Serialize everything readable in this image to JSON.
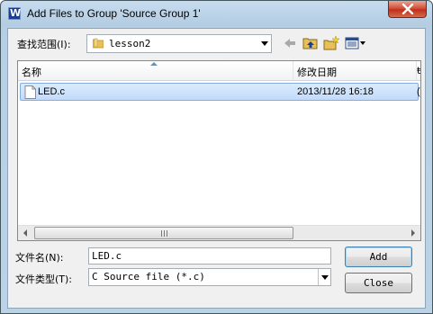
{
  "window": {
    "title": "Add Files to Group 'Source Group 1'"
  },
  "lookin": {
    "label": "查找范围(I):",
    "value": "lesson2"
  },
  "toolbar": {
    "back_icon": "back-arrow-icon",
    "up_icon": "up-folder-icon",
    "new_icon": "new-folder-icon",
    "view_icon": "view-menu-icon"
  },
  "list": {
    "columns": [
      {
        "label": "名称"
      },
      {
        "label": "修改日期"
      },
      {
        "label": "ŧ"
      }
    ],
    "rows": [
      {
        "name": "LED.c",
        "modified": "2013/11/28 16:18",
        "extra": "("
      }
    ]
  },
  "filename": {
    "label": "文件名(N):",
    "value": "LED.c"
  },
  "filetype": {
    "label": "文件类型(T):",
    "value": "C Source file (*.c)"
  },
  "buttons": {
    "add": "Add",
    "close": "Close"
  },
  "colors": {
    "selection": "#cce4fc",
    "title_close": "#c7402d",
    "folder": "#e8c05a"
  }
}
